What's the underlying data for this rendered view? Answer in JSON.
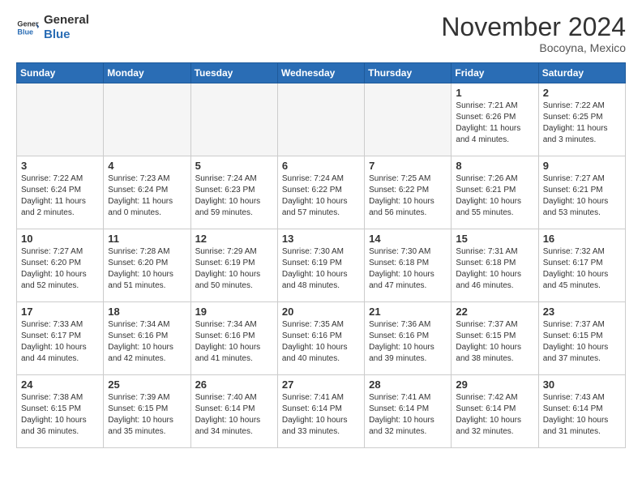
{
  "header": {
    "logo_line1": "General",
    "logo_line2": "Blue",
    "month": "November 2024",
    "location": "Bocoyna, Mexico"
  },
  "weekdays": [
    "Sunday",
    "Monday",
    "Tuesday",
    "Wednesday",
    "Thursday",
    "Friday",
    "Saturday"
  ],
  "weeks": [
    [
      {
        "day": "",
        "info": ""
      },
      {
        "day": "",
        "info": ""
      },
      {
        "day": "",
        "info": ""
      },
      {
        "day": "",
        "info": ""
      },
      {
        "day": "",
        "info": ""
      },
      {
        "day": "1",
        "info": "Sunrise: 7:21 AM\nSunset: 6:26 PM\nDaylight: 11 hours and 4 minutes."
      },
      {
        "day": "2",
        "info": "Sunrise: 7:22 AM\nSunset: 6:25 PM\nDaylight: 11 hours and 3 minutes."
      }
    ],
    [
      {
        "day": "3",
        "info": "Sunrise: 7:22 AM\nSunset: 6:24 PM\nDaylight: 11 hours and 2 minutes."
      },
      {
        "day": "4",
        "info": "Sunrise: 7:23 AM\nSunset: 6:24 PM\nDaylight: 11 hours and 0 minutes."
      },
      {
        "day": "5",
        "info": "Sunrise: 7:24 AM\nSunset: 6:23 PM\nDaylight: 10 hours and 59 minutes."
      },
      {
        "day": "6",
        "info": "Sunrise: 7:24 AM\nSunset: 6:22 PM\nDaylight: 10 hours and 57 minutes."
      },
      {
        "day": "7",
        "info": "Sunrise: 7:25 AM\nSunset: 6:22 PM\nDaylight: 10 hours and 56 minutes."
      },
      {
        "day": "8",
        "info": "Sunrise: 7:26 AM\nSunset: 6:21 PM\nDaylight: 10 hours and 55 minutes."
      },
      {
        "day": "9",
        "info": "Sunrise: 7:27 AM\nSunset: 6:21 PM\nDaylight: 10 hours and 53 minutes."
      }
    ],
    [
      {
        "day": "10",
        "info": "Sunrise: 7:27 AM\nSunset: 6:20 PM\nDaylight: 10 hours and 52 minutes."
      },
      {
        "day": "11",
        "info": "Sunrise: 7:28 AM\nSunset: 6:20 PM\nDaylight: 10 hours and 51 minutes."
      },
      {
        "day": "12",
        "info": "Sunrise: 7:29 AM\nSunset: 6:19 PM\nDaylight: 10 hours and 50 minutes."
      },
      {
        "day": "13",
        "info": "Sunrise: 7:30 AM\nSunset: 6:19 PM\nDaylight: 10 hours and 48 minutes."
      },
      {
        "day": "14",
        "info": "Sunrise: 7:30 AM\nSunset: 6:18 PM\nDaylight: 10 hours and 47 minutes."
      },
      {
        "day": "15",
        "info": "Sunrise: 7:31 AM\nSunset: 6:18 PM\nDaylight: 10 hours and 46 minutes."
      },
      {
        "day": "16",
        "info": "Sunrise: 7:32 AM\nSunset: 6:17 PM\nDaylight: 10 hours and 45 minutes."
      }
    ],
    [
      {
        "day": "17",
        "info": "Sunrise: 7:33 AM\nSunset: 6:17 PM\nDaylight: 10 hours and 44 minutes."
      },
      {
        "day": "18",
        "info": "Sunrise: 7:34 AM\nSunset: 6:16 PM\nDaylight: 10 hours and 42 minutes."
      },
      {
        "day": "19",
        "info": "Sunrise: 7:34 AM\nSunset: 6:16 PM\nDaylight: 10 hours and 41 minutes."
      },
      {
        "day": "20",
        "info": "Sunrise: 7:35 AM\nSunset: 6:16 PM\nDaylight: 10 hours and 40 minutes."
      },
      {
        "day": "21",
        "info": "Sunrise: 7:36 AM\nSunset: 6:16 PM\nDaylight: 10 hours and 39 minutes."
      },
      {
        "day": "22",
        "info": "Sunrise: 7:37 AM\nSunset: 6:15 PM\nDaylight: 10 hours and 38 minutes."
      },
      {
        "day": "23",
        "info": "Sunrise: 7:37 AM\nSunset: 6:15 PM\nDaylight: 10 hours and 37 minutes."
      }
    ],
    [
      {
        "day": "24",
        "info": "Sunrise: 7:38 AM\nSunset: 6:15 PM\nDaylight: 10 hours and 36 minutes."
      },
      {
        "day": "25",
        "info": "Sunrise: 7:39 AM\nSunset: 6:15 PM\nDaylight: 10 hours and 35 minutes."
      },
      {
        "day": "26",
        "info": "Sunrise: 7:40 AM\nSunset: 6:14 PM\nDaylight: 10 hours and 34 minutes."
      },
      {
        "day": "27",
        "info": "Sunrise: 7:41 AM\nSunset: 6:14 PM\nDaylight: 10 hours and 33 minutes."
      },
      {
        "day": "28",
        "info": "Sunrise: 7:41 AM\nSunset: 6:14 PM\nDaylight: 10 hours and 32 minutes."
      },
      {
        "day": "29",
        "info": "Sunrise: 7:42 AM\nSunset: 6:14 PM\nDaylight: 10 hours and 32 minutes."
      },
      {
        "day": "30",
        "info": "Sunrise: 7:43 AM\nSunset: 6:14 PM\nDaylight: 10 hours and 31 minutes."
      }
    ]
  ]
}
